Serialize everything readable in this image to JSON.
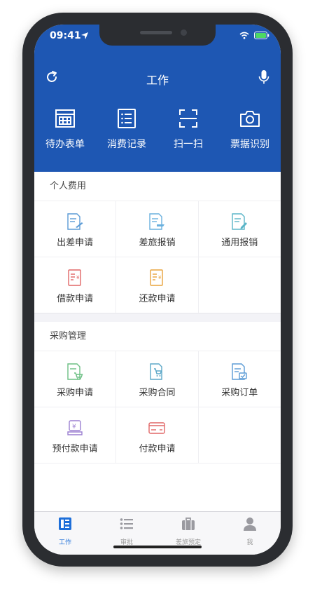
{
  "status": {
    "time": "09:41"
  },
  "navbar": {
    "title": "工作",
    "left_icon": "refresh-icon",
    "right_icon": "microphone-icon"
  },
  "quick": [
    {
      "label": "待办表单",
      "icon": "form-icon"
    },
    {
      "label": "消费记录",
      "icon": "list-icon"
    },
    {
      "label": "扫一扫",
      "icon": "scan-icon"
    },
    {
      "label": "票据识别",
      "icon": "camera-icon"
    }
  ],
  "sections": [
    {
      "title": "个人费用",
      "items": [
        {
          "label": "出差申请",
          "icon": "travel-request-icon",
          "color": "#5b9bd5"
        },
        {
          "label": "差旅报销",
          "icon": "travel-reimburse-icon",
          "color": "#6ab0de"
        },
        {
          "label": "通用报销",
          "icon": "general-reimburse-icon",
          "color": "#5bb5c8"
        },
        {
          "label": "借款申请",
          "icon": "loan-request-icon",
          "color": "#e06666"
        },
        {
          "label": "还款申请",
          "icon": "repay-request-icon",
          "color": "#e8a33c"
        }
      ]
    },
    {
      "title": "采购管理",
      "items": [
        {
          "label": "采购申请",
          "icon": "purchase-request-icon",
          "color": "#6cbf84"
        },
        {
          "label": "采购合同",
          "icon": "purchase-contract-icon",
          "color": "#5ba7c7"
        },
        {
          "label": "采购订单",
          "icon": "purchase-order-icon",
          "color": "#5b9bd5"
        },
        {
          "label": "预付款申请",
          "icon": "prepay-request-icon",
          "color": "#9b7fd1"
        },
        {
          "label": "付款申请",
          "icon": "payment-request-icon",
          "color": "#e06666"
        }
      ]
    }
  ],
  "tabs": [
    {
      "label": "工作",
      "icon": "work-icon",
      "active": true
    },
    {
      "label": "审批",
      "icon": "approval-icon",
      "active": false
    },
    {
      "label": "差旅预定",
      "icon": "suitcase-icon",
      "active": false
    },
    {
      "label": "我",
      "icon": "person-icon",
      "active": false
    }
  ],
  "colors": {
    "brand": "#1e57b3",
    "active_tab": "#1e6fd9",
    "inactive_tab": "#999999"
  }
}
